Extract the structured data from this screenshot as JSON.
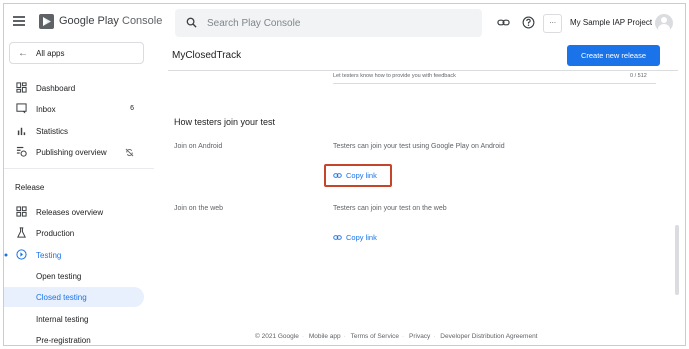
{
  "header": {
    "brand_prefix": "Google Play",
    "brand_suffix": "Console",
    "search_placeholder": "Search Play Console",
    "more_label": "···",
    "project_name": "My Sample IAP Project"
  },
  "sidebar": {
    "all_apps": "All apps",
    "items": [
      {
        "label": "Dashboard",
        "icon": "dashboard-icon"
      },
      {
        "label": "Inbox",
        "icon": "inbox-icon",
        "count": "6"
      },
      {
        "label": "Statistics",
        "icon": "statistics-icon"
      },
      {
        "label": "Publishing overview",
        "icon": "publishing-overview-icon",
        "trailing_icon": "sync-off-icon"
      }
    ],
    "release_section": "Release",
    "release_items": [
      {
        "label": "Releases overview",
        "icon": "releases-overview-icon"
      },
      {
        "label": "Production",
        "icon": "production-icon"
      },
      {
        "label": "Testing",
        "icon": "testing-icon",
        "selected": true
      }
    ],
    "testing_items": [
      {
        "label": "Open testing"
      },
      {
        "label": "Closed testing",
        "active": true
      },
      {
        "label": "Internal testing"
      },
      {
        "label": "Pre-registration"
      }
    ]
  },
  "main": {
    "title": "MyClosedTrack",
    "create_button": "Create new release",
    "feedback_hint": "Let testers know how to provide you with feedback",
    "feedback_counter": "0 / 512",
    "join_section_title": "How testers join your test",
    "join_android_label": "Join on Android",
    "join_android_desc": "Testers can join your test using Google Play on Android",
    "join_android_copy": "Copy link",
    "join_web_label": "Join on the web",
    "join_web_desc": "Testers can join your test on the web",
    "join_web_copy": "Copy link"
  },
  "footer": {
    "copyright": "© 2021 Google",
    "links": [
      "Mobile app",
      "Terms of Service",
      "Privacy",
      "Developer Distribution Agreement"
    ]
  },
  "colors": {
    "accent": "#1a73e8",
    "highlight_box": "#c5452a",
    "active_bg": "#e8f0fe"
  }
}
